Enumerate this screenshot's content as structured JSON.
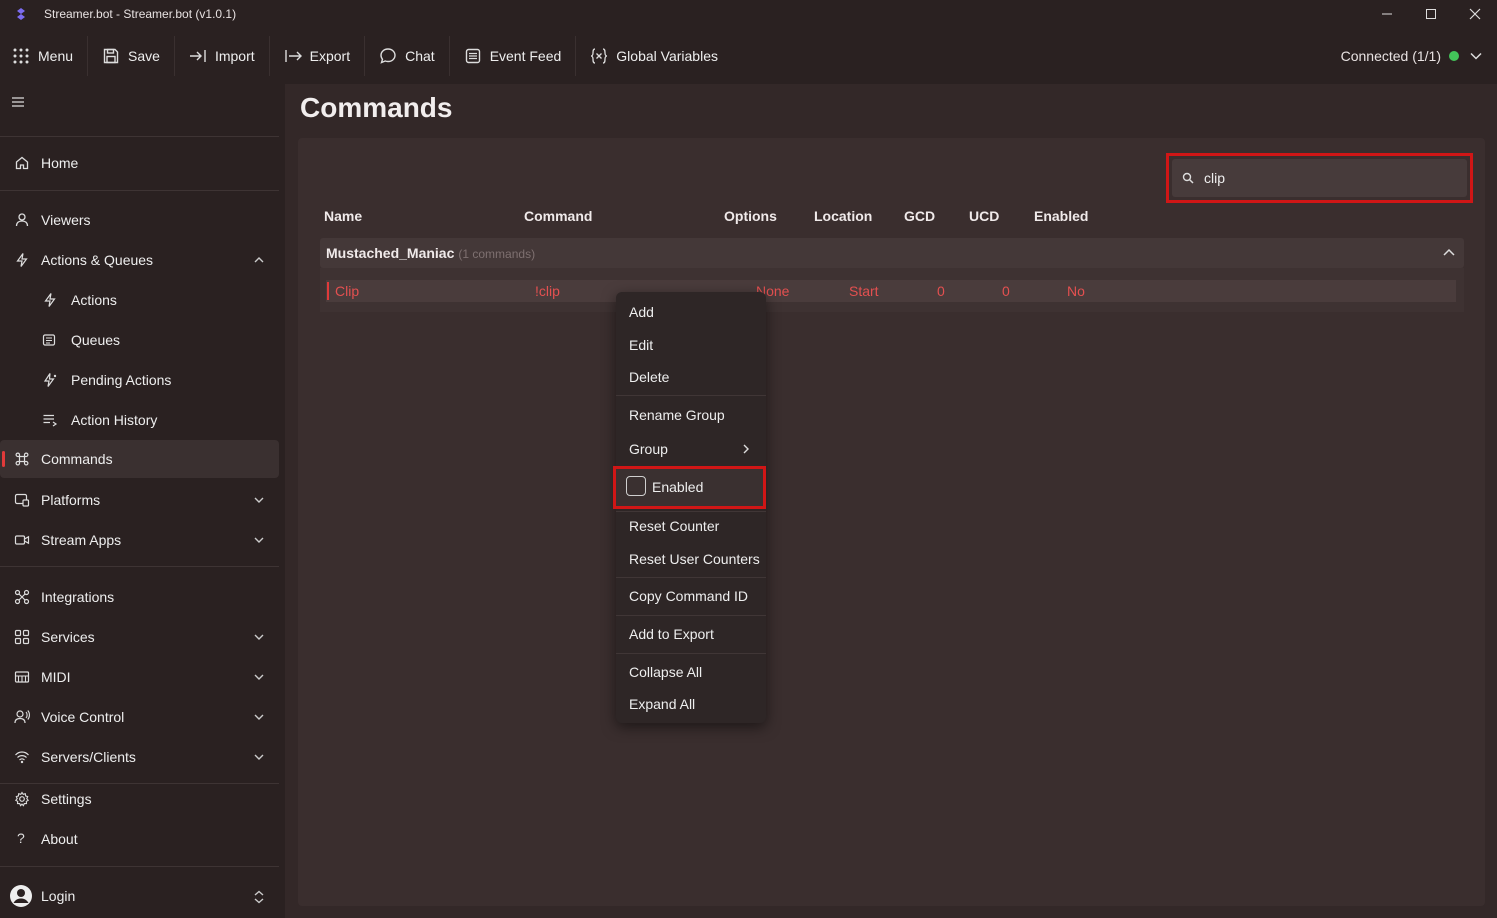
{
  "window": {
    "title": "Streamer.bot - Streamer.bot (v1.0.1)"
  },
  "toolbar": {
    "menu": "Menu",
    "save": "Save",
    "import": "Import",
    "export": "Export",
    "chat": "Chat",
    "event_feed": "Event Feed",
    "global_variables": "Global Variables",
    "connection_status": "Connected (1/1)"
  },
  "sidebar": {
    "home": "Home",
    "viewers": "Viewers",
    "actions_queues": "Actions & Queues",
    "actions": "Actions",
    "queues": "Queues",
    "pending_actions": "Pending Actions",
    "action_history": "Action History",
    "commands": "Commands",
    "platforms": "Platforms",
    "stream_apps": "Stream Apps",
    "integrations": "Integrations",
    "services": "Services",
    "midi": "MIDI",
    "voice_control": "Voice Control",
    "servers_clients": "Servers/Clients",
    "settings": "Settings",
    "about": "About",
    "login": "Login"
  },
  "main": {
    "page_title": "Commands",
    "search_value": "clip",
    "columns": {
      "name": "Name",
      "command": "Command",
      "options": "Options",
      "location": "Location",
      "gcd": "GCD",
      "ucd": "UCD",
      "enabled": "Enabled"
    },
    "group": {
      "name": "Mustached_Maniac",
      "count": "(1 commands)"
    },
    "row": {
      "name": "Clip",
      "command": "!clip",
      "options": "None",
      "location": "Start",
      "gcd": "0",
      "ucd": "0",
      "enabled": "No"
    }
  },
  "context_menu": {
    "add": "Add",
    "edit": "Edit",
    "delete": "Delete",
    "rename_group": "Rename Group",
    "group": "Group",
    "enabled": "Enabled",
    "reset_counter": "Reset Counter",
    "reset_user_counters": "Reset User Counters",
    "copy_command_id": "Copy Command ID",
    "add_to_export": "Add to Export",
    "collapse_all": "Collapse All",
    "expand_all": "Expand All"
  },
  "colors": {
    "accent": "#e03a3a",
    "status_ok": "#43c55a",
    "highlight_box": "#d01616"
  }
}
